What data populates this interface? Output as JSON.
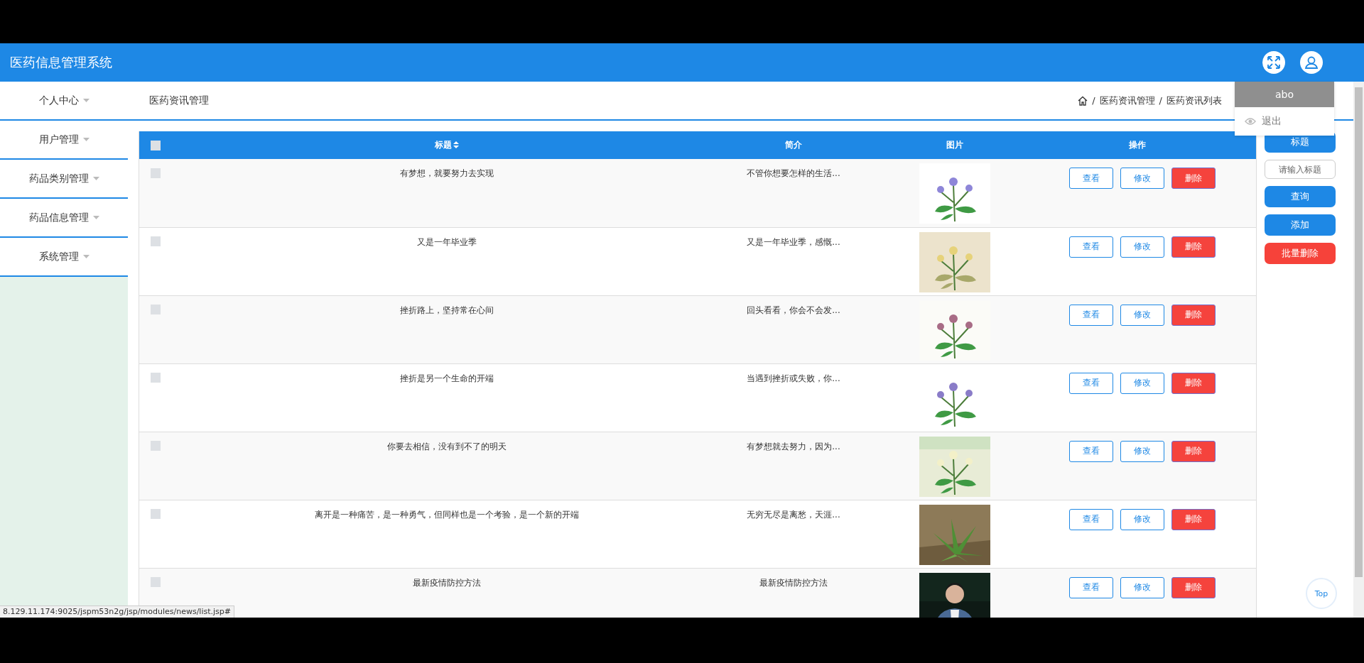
{
  "header": {
    "title": "医药信息管理系统"
  },
  "user_menu": {
    "username": "abo",
    "items": [
      {
        "label": "退出"
      }
    ]
  },
  "sidebar": {
    "items": [
      {
        "label": "个人中心",
        "expanded": false
      },
      {
        "label": "用户管理",
        "expanded": false
      },
      {
        "label": "药品类别管理",
        "expanded": false
      },
      {
        "label": "药品信息管理",
        "expanded": false
      },
      {
        "label": "系统管理",
        "expanded": false
      }
    ]
  },
  "page_title": "医药资讯管理",
  "breadcrumb": {
    "separator": "/",
    "items": [
      "医药资讯管理",
      "医药资讯列表"
    ]
  },
  "table": {
    "header_checked": false,
    "columns": [
      "标题",
      "简介",
      "图片",
      "操作"
    ],
    "rows": [
      {
        "checked": false,
        "title": "有梦想，就要努力去实现",
        "summary": "不管你想要怎样的生活...",
        "image": {
          "kind": "picture"
        },
        "actions": [
          "查看",
          "修改",
          "删除"
        ]
      },
      {
        "checked": false,
        "title": "又是一年毕业季",
        "summary": "又是一年毕业季，感慨...",
        "image": {
          "kind": "picture"
        },
        "actions": [
          "查看",
          "修改",
          "删除"
        ]
      },
      {
        "checked": false,
        "title": "挫折路上，坚持常在心间",
        "summary": "回头看看，你会不会发...",
        "image": {
          "kind": "picture"
        },
        "actions": [
          "查看",
          "修改",
          "删除"
        ]
      },
      {
        "checked": false,
        "title": "挫折是另一个生命的开端",
        "summary": "当遇到挫折或失败，你...",
        "image": {
          "kind": "picture"
        },
        "actions": [
          "查看",
          "修改",
          "删除"
        ]
      },
      {
        "checked": false,
        "title": "你要去相信，没有到不了的明天",
        "summary": "有梦想就去努力，因为...",
        "image": {
          "kind": "picture"
        },
        "actions": [
          "查看",
          "修改",
          "删除"
        ]
      },
      {
        "checked": false,
        "title": "离开是一种痛苦，是一种勇气，但同样也是一个考验，是一个新的开端",
        "summary": "无穷无尽是离愁，天涯...",
        "image": {
          "kind": "picture"
        },
        "actions": [
          "查看",
          "修改",
          "删除"
        ]
      },
      {
        "checked": false,
        "title": "最新疫情防控方法",
        "summary": "最新疫情防控方法",
        "image": {
          "kind": "picture"
        },
        "actions": [
          "查看",
          "修改",
          "删除"
        ]
      }
    ]
  },
  "search_panel": {
    "field_label": "标题",
    "placeholder": "请输入标题",
    "buttons": [
      {
        "label": "查询",
        "kind": "primary"
      },
      {
        "label": "添加",
        "kind": "primary"
      },
      {
        "label": "批量删除",
        "kind": "danger"
      }
    ]
  },
  "back_to_top": "Top",
  "status_url": "8.129.11.174:9025/jspm53n2g/jsp/modules/news/list.jsp#"
}
